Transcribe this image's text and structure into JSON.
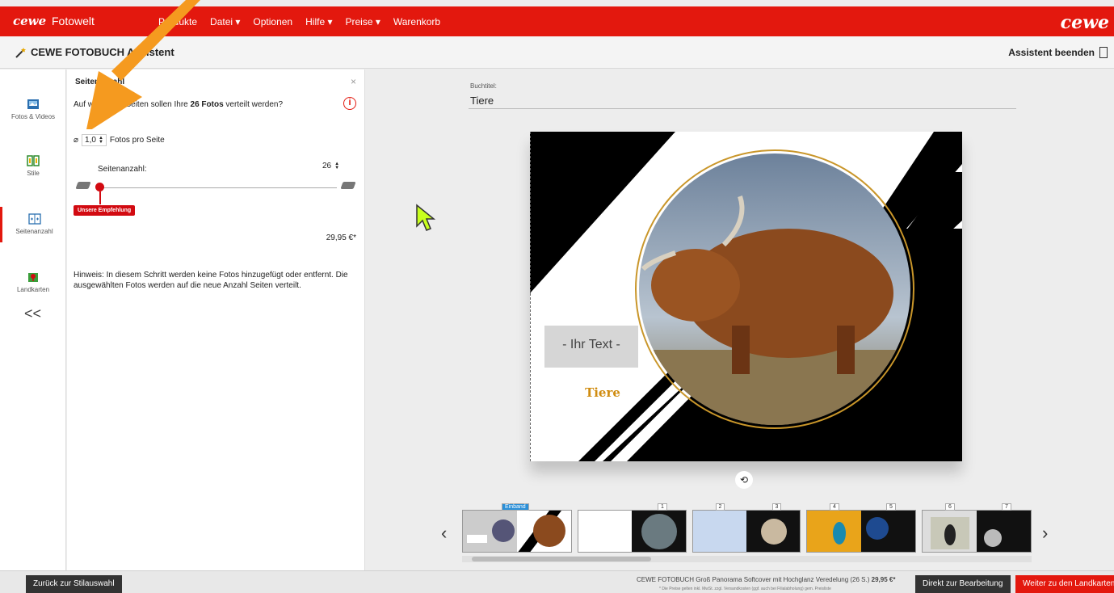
{
  "topbar": {
    "brand": "cewe",
    "brand_sub": "Fotowelt",
    "menu": [
      "Produkte",
      "Datei ▾",
      "Optionen",
      "Hilfe ▾",
      "Preise ▾",
      "Warenkorb"
    ],
    "brand_right": "cewe",
    "accent": "#e3180e"
  },
  "subbar": {
    "title": "CEWE FOTOBUCH Assistent",
    "end_label": "Assistent beenden"
  },
  "leftnav": {
    "items": [
      {
        "label": "Fotos & Videos",
        "icon": "photo-icon"
      },
      {
        "label": "Stile",
        "icon": "style-icon"
      },
      {
        "label": "Seitenanzahl",
        "icon": "pages-icon"
      },
      {
        "label": "Landkarten",
        "icon": "map-icon"
      }
    ],
    "collapse": "<<"
  },
  "panel": {
    "heading": "Seitenanzahl",
    "close": "×",
    "question_pre": "Auf wie vielen Seiten sollen Ihre ",
    "question_bold": "26 Fotos",
    "question_post": " verteilt werden?",
    "avg_symbol": "⌀",
    "photos_per_page": "1,0",
    "photos_per_page_label": "Fotos pro Seite",
    "page_count_label": "Seitenanzahl:",
    "page_count": "26",
    "recommend": "Unsere Empfehlung",
    "price": "29,95 €*",
    "hint": "Hinweis: In diesem Schritt werden keine Fotos hinzugefügt oder entfernt. Die ausgewählten Fotos werden auf die neue Anzahl Seiten verteilt."
  },
  "book": {
    "title_label": "Buchtitel:",
    "title_value": "Tiere",
    "text_placeholder": "- Ihr Text -",
    "cover_title": "Tiere"
  },
  "strip": {
    "labels": [
      "Einband",
      "1",
      "2",
      "3",
      "4",
      "5",
      "6",
      "7"
    ]
  },
  "footer": {
    "back": "Zurück zur Stilauswahl",
    "summary": "CEWE FOTOBUCH Groß Panorama Softcover mit Hochglanz Veredelung (26 S.)",
    "summary_price": "29,95 €*",
    "summary_note": "* Die Preise gelten inkl. MwSt. zzgl. Versandkosten (ggf. auch bei Filialabholung) gem. Preisliste",
    "edit": "Direkt zur Bearbeitung",
    "next": "Weiter zu den Landkarten"
  }
}
